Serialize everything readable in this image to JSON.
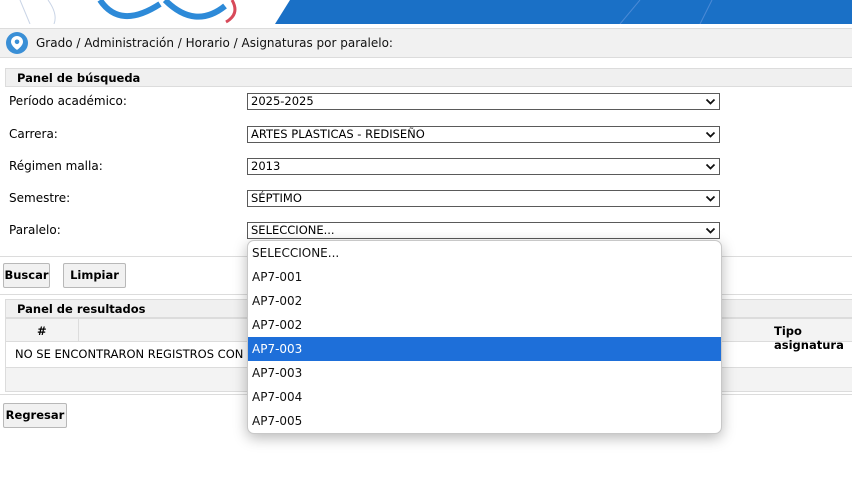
{
  "breadcrumb": {
    "text": "Grado / Administración / Horario / Asignaturas por paralelo:"
  },
  "search_panel": {
    "title": "Panel de búsqueda",
    "fields": [
      {
        "label": "Período académico:",
        "value": "2025-2025"
      },
      {
        "label": "Carrera:",
        "value": "ARTES PLASTICAS - REDISEÑO"
      },
      {
        "label": "Régimen malla:",
        "value": "2013"
      },
      {
        "label": "Semestre:",
        "value": "SÉPTIMO"
      },
      {
        "label": "Paralelo:",
        "value": "SELECCIONE..."
      }
    ]
  },
  "buttons": {
    "search": "Buscar",
    "clear": "Limpiar",
    "back": "Regresar"
  },
  "results_panel": {
    "title": "Panel de resultados",
    "columns": [
      "#",
      "Tipo asignatura"
    ],
    "empty_message": "NO SE ENCONTRARON REGISTROS CON LOS"
  },
  "dropdown": {
    "options": [
      "SELECCIONE...",
      "AP7-001",
      "AP7-002",
      "AP7-002",
      "AP7-003",
      "AP7-003",
      "AP7-004",
      "AP7-005"
    ],
    "highlighted_index": 4
  },
  "colors": {
    "banner_blue": "#1a70c6",
    "highlight": "#1e6fd9",
    "pin": "#3a8fd6"
  }
}
